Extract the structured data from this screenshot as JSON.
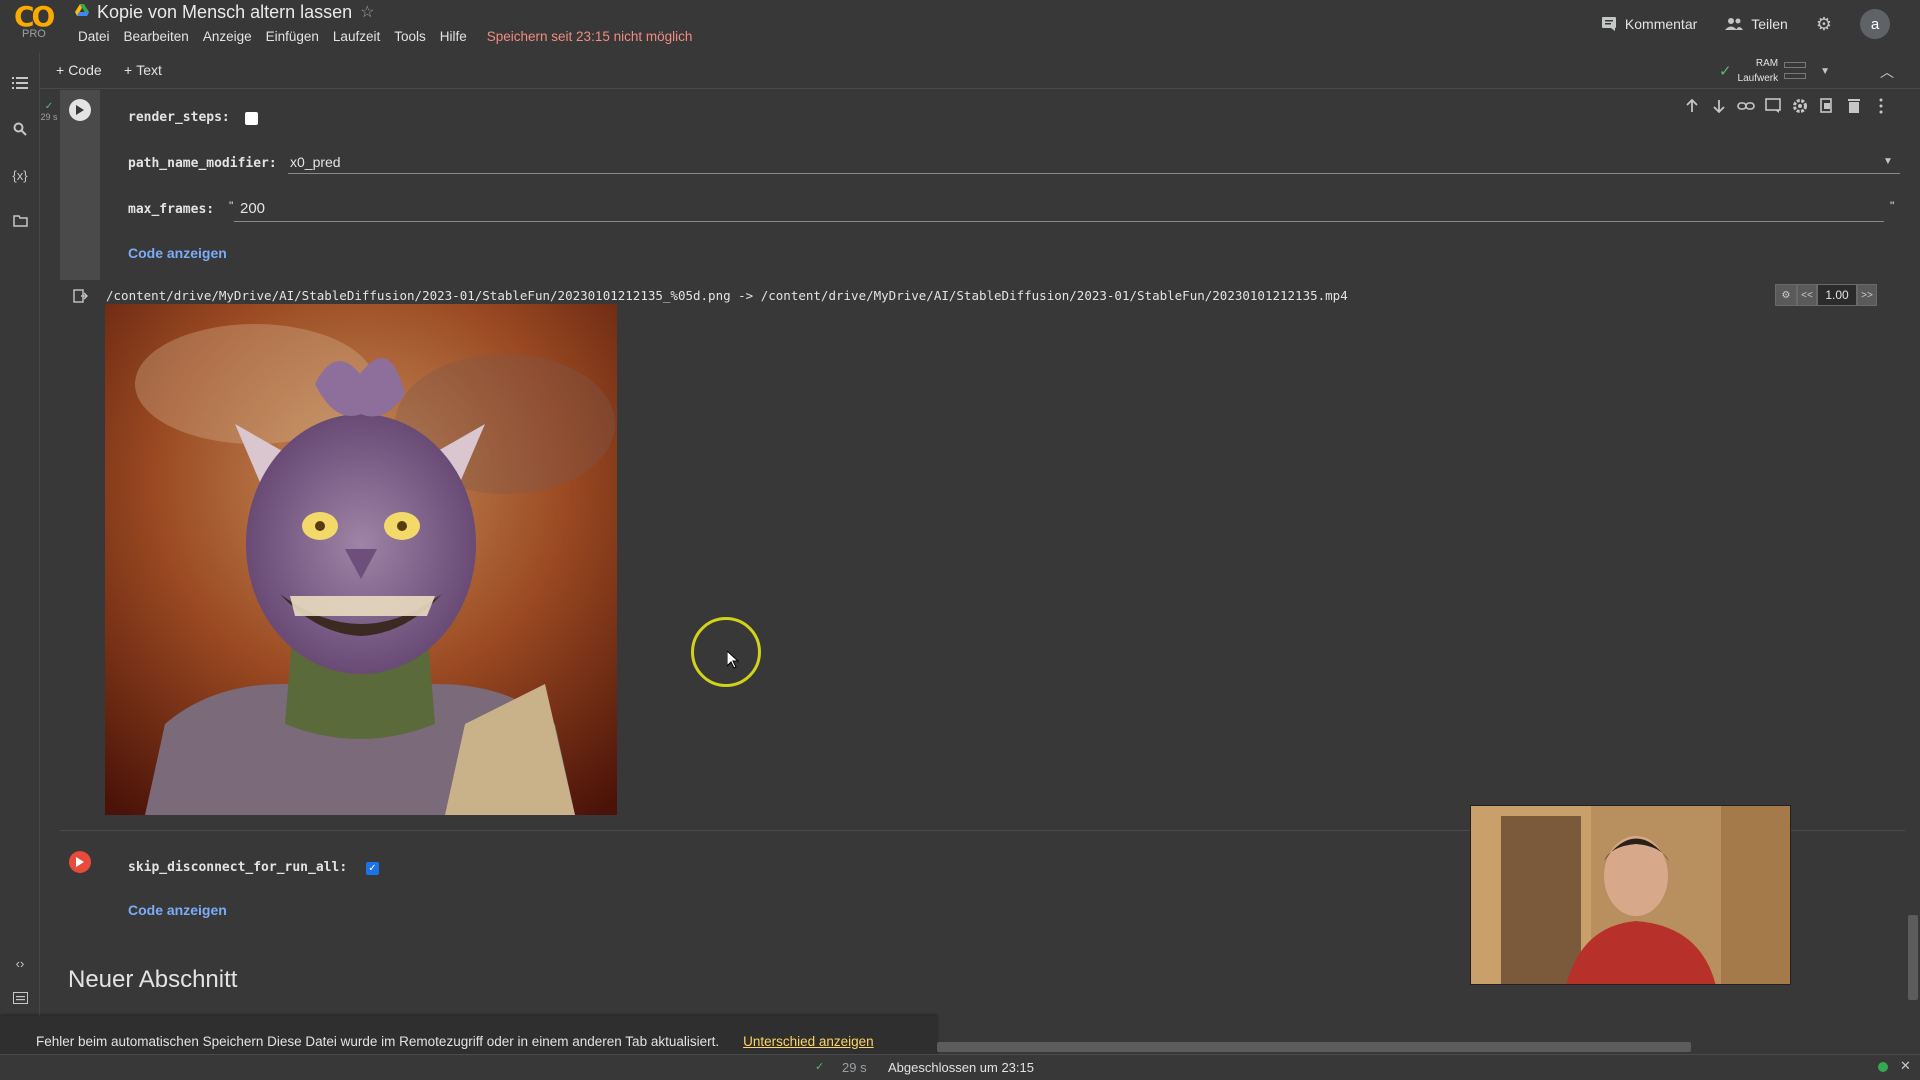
{
  "app": {
    "logo_text": "CO",
    "logo_badge": "PRO",
    "notebook_title": "Kopie von Mensch altern lassen",
    "menu": [
      "Datei",
      "Bearbeiten",
      "Anzeige",
      "Einfügen",
      "Laufzeit",
      "Tools",
      "Hilfe"
    ],
    "save_warning": "Speichern seit 23:15 nicht möglich",
    "comment_label": "Kommentar",
    "share_label": "Teilen",
    "avatar_letter": "a"
  },
  "toolbar": {
    "add_code": "Code",
    "add_text": "Text",
    "ram_label": "RAM",
    "disk_label": "Laufwerk"
  },
  "cell1": {
    "exec_time": "29 s",
    "render_steps_label": "render_steps:",
    "render_steps_checked": false,
    "path_label": "path_name_modifier:",
    "path_value": "x0_pred",
    "max_frames_label": "max_frames:",
    "max_frames_value": "200",
    "quote_open": "\"",
    "quote_close": "\"",
    "show_code": "Code anzeigen"
  },
  "output": {
    "path_text": "/content/drive/MyDrive/AI/StableDiffusion/2023-01/StableFun/20230101212135_%05d.png -> /content/drive/MyDrive/AI/StableDiffusion/2023-01/StableFun/20230101212135.mp4",
    "prev_label": "<<",
    "next_label": ">>",
    "speed_value": "1.00"
  },
  "cell2": {
    "skip_label": "skip_disconnect_for_run_all:",
    "skip_checked": true,
    "show_code": "Code anzeigen"
  },
  "section": {
    "heading": "Neuer Abschnitt"
  },
  "toast": {
    "message": "Fehler beim automatischen Speichern Diese Datei wurde im Remotezugriff oder in einem anderen Tab aktualisiert.",
    "link": "Unterschied anzeigen"
  },
  "statusbar": {
    "exec_time": "29 s",
    "completed": "Abgeschlossen um 23:15"
  },
  "colors": {
    "background": "#383838",
    "accent_link": "#7cacf8",
    "warning": "#f28b82",
    "checkbox_checked": "#1a73e8",
    "run_error": "#e84a3c",
    "cursor_ring": "#d2d21c"
  }
}
